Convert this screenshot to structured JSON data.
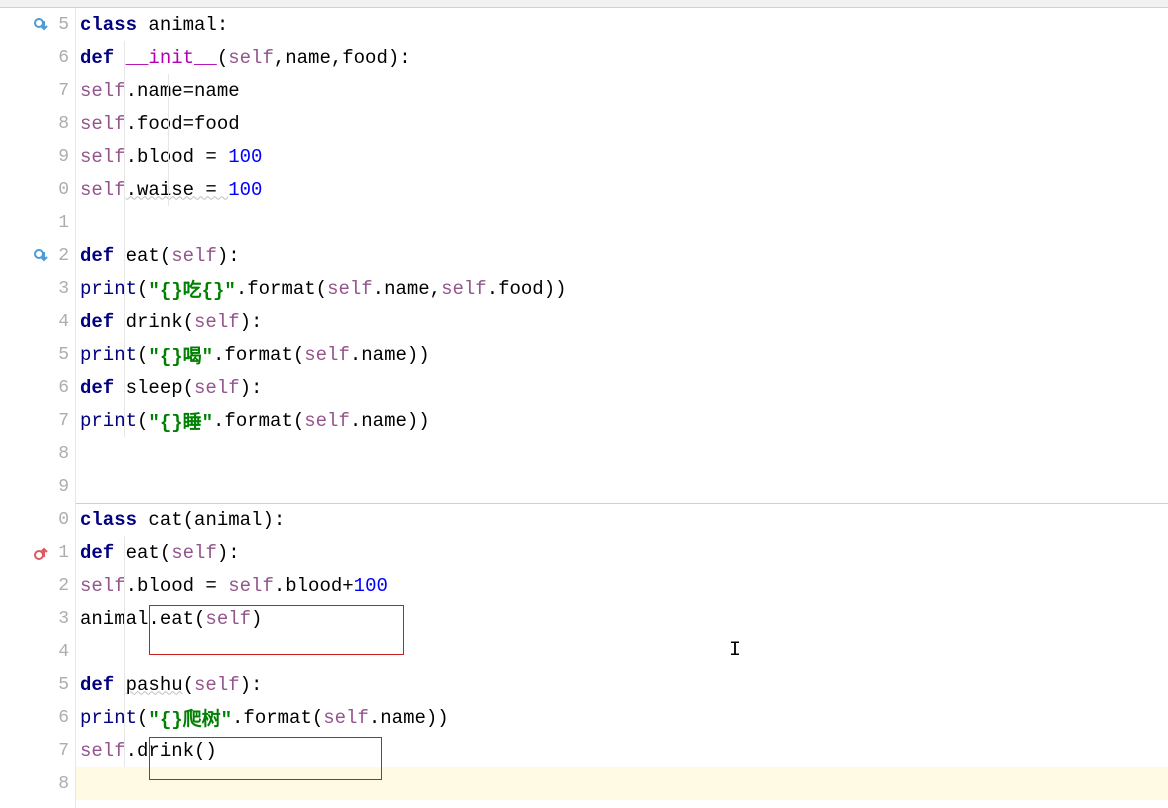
{
  "lines": [
    {
      "num": "5",
      "icon": "override-down",
      "fold": "start"
    },
    {
      "num": "6",
      "fold": "start"
    },
    {
      "num": "7"
    },
    {
      "num": "8"
    },
    {
      "num": "9"
    },
    {
      "num": "0",
      "fold": "end"
    },
    {
      "num": "1"
    },
    {
      "num": "2",
      "icon": "override-down",
      "fold": "start"
    },
    {
      "num": "3",
      "fold": "end"
    },
    {
      "num": "4",
      "fold": "start"
    },
    {
      "num": "5",
      "fold": "end"
    },
    {
      "num": "6",
      "fold": "start"
    },
    {
      "num": "7",
      "fold": "end"
    },
    {
      "num": "8"
    },
    {
      "num": "9"
    },
    {
      "num": "0",
      "fold": "start"
    },
    {
      "num": "1",
      "icon": "override-up",
      "fold": "start"
    },
    {
      "num": "2"
    },
    {
      "num": "3",
      "fold": "end"
    },
    {
      "num": "4"
    },
    {
      "num": "5",
      "fold": "start"
    },
    {
      "num": "6"
    },
    {
      "num": "7",
      "fold": "end"
    },
    {
      "num": "8",
      "hl": true
    }
  ],
  "code": {
    "l0": {
      "kw": "class ",
      "name": "animal",
      ":": ":"
    },
    "l1": {
      "kw": "def ",
      "magic": "__init__",
      "args": "(self,name,food):"
    },
    "l2": {
      "self": "self",
      "rest": ".name=name"
    },
    "l3": {
      "self": "self",
      "rest": ".food=food"
    },
    "l4": {
      "self": "self",
      "rest": ".blood = ",
      "num": "100"
    },
    "l5": {
      "self": "self",
      "rest": ".waise = ",
      "num": "100"
    },
    "l7": {
      "kw": "def ",
      "fn": "eat",
      "args": "(self):"
    },
    "l8": {
      "bi": "print",
      "open": "(",
      "str": "\"{}吃{}\"",
      "mid": ".format(",
      "self1": "self",
      "dot1": ".name,",
      "self2": "self",
      "dot2": ".food))"
    },
    "l9": {
      "kw": "def ",
      "fn": "drink",
      "args": "(self):"
    },
    "l10": {
      "bi": "print",
      "open": "(",
      "str": "\"{}喝\"",
      "mid": ".format(",
      "self": "self",
      "rest": ".name))"
    },
    "l11": {
      "kw": "def ",
      "fn": "sleep",
      "args": "(self):"
    },
    "l12": {
      "bi": "print",
      "open": "(",
      "str": "\"{}睡\"",
      "mid": ".format(",
      "self": "self",
      "rest": ".name))"
    },
    "l15": {
      "kw": "class ",
      "name": "cat",
      "args": "(animal):"
    },
    "l16": {
      "kw": "def ",
      "fn": "eat",
      "args": "(self):"
    },
    "l17": {
      "self": "self",
      "rest1": ".blood = ",
      "self2": "self",
      "rest2": ".blood+",
      "num": "100"
    },
    "l18": {
      "plain": "animal.eat(",
      "self": "self",
      "close": ")"
    },
    "l20": {
      "kw": "def ",
      "fn": "pashu",
      "args": "(self):"
    },
    "l21": {
      "bi": "print",
      "open": "(",
      "str": "\"{}爬树\"",
      "mid": ".format(",
      "self": "self",
      "rest": ".name))"
    },
    "l22": {
      "self": "self",
      "rest": ".drink()"
    }
  },
  "cursor": {
    "glyph": "I"
  }
}
